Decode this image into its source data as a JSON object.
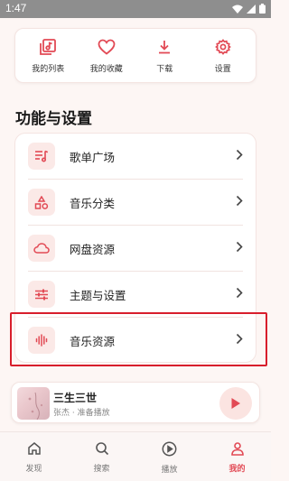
{
  "status_bar": {
    "time": "1:47"
  },
  "quick_actions": [
    {
      "label": "我的列表",
      "icon": "playlist-icon"
    },
    {
      "label": "我的收藏",
      "icon": "heart-icon"
    },
    {
      "label": "下载",
      "icon": "download-icon"
    },
    {
      "label": "设置",
      "icon": "gear-icon"
    }
  ],
  "section": {
    "title": "功能与设置"
  },
  "menu_items": [
    {
      "label": "歌单广场",
      "icon": "music-list-icon"
    },
    {
      "label": "音乐分类",
      "icon": "category-icon"
    },
    {
      "label": "网盘资源",
      "icon": "cloud-icon"
    },
    {
      "label": "主题与设置",
      "icon": "sliders-icon"
    },
    {
      "label": "音乐资源",
      "icon": "waveform-icon"
    }
  ],
  "player": {
    "title": "三生三世",
    "subtitle": "张杰 · 准备播放"
  },
  "tabs": [
    {
      "label": "发现",
      "icon": "home-icon",
      "active": false
    },
    {
      "label": "搜索",
      "icon": "search-icon",
      "active": false
    },
    {
      "label": "播放",
      "icon": "play-circle-icon",
      "active": false
    },
    {
      "label": "我的",
      "icon": "user-icon",
      "active": true
    }
  ],
  "colors": {
    "accent": "#e24a55",
    "highlight_border": "#d81e2c",
    "background": "#fdf6f4"
  }
}
